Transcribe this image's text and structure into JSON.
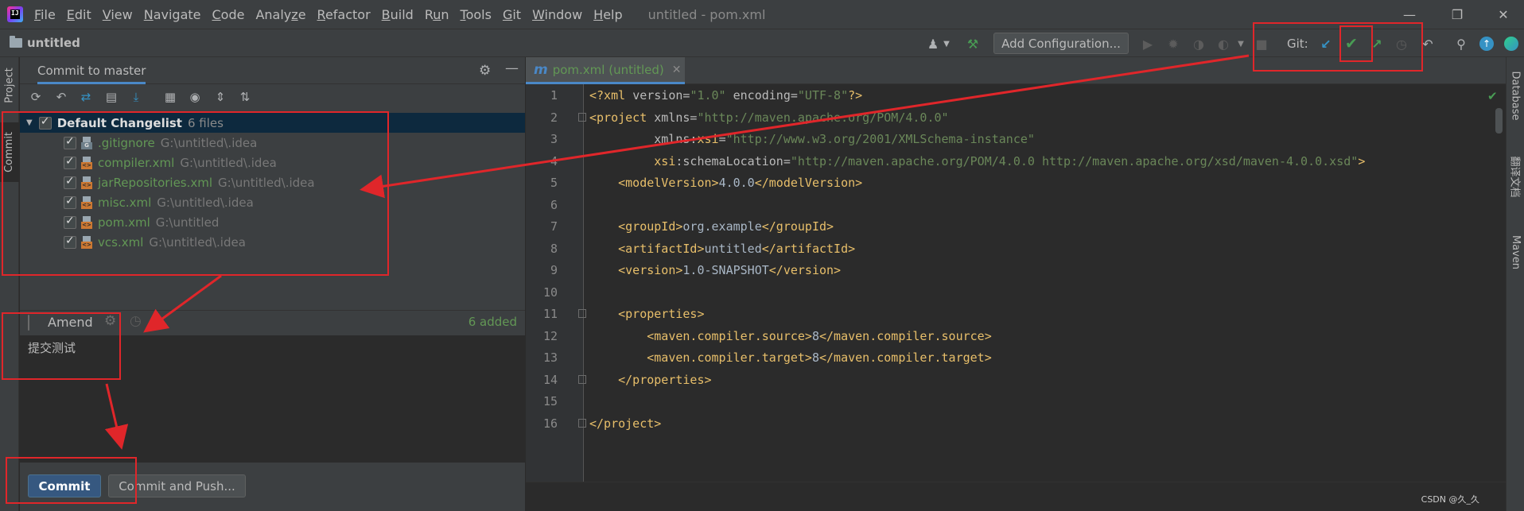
{
  "app": {
    "window_title": "untitled - pom.xml",
    "menu": [
      "File",
      "Edit",
      "View",
      "Navigate",
      "Code",
      "Analyze",
      "Refactor",
      "Build",
      "Run",
      "Tools",
      "Git",
      "Window",
      "Help"
    ],
    "menu_mnemonics": [
      "F",
      "E",
      "V",
      "N",
      "C",
      "z",
      "R",
      "B",
      "u",
      "T",
      "G",
      "W",
      "H"
    ]
  },
  "navbar": {
    "project": "untitled",
    "add_configuration": "Add Configuration...",
    "git_label": "Git:"
  },
  "left_stripe": {
    "project_tab": "Project",
    "commit_tab": "Commit"
  },
  "commit_panel": {
    "title": "Commit to master",
    "changelist": {
      "name": "Default Changelist",
      "count": "6 files",
      "files": [
        {
          "name": ".gitignore",
          "path": "G:\\untitled\\.idea"
        },
        {
          "name": "compiler.xml",
          "path": "G:\\untitled\\.idea"
        },
        {
          "name": "jarRepositories.xml",
          "path": "G:\\untitled\\.idea"
        },
        {
          "name": "misc.xml",
          "path": "G:\\untitled\\.idea"
        },
        {
          "name": "pom.xml",
          "path": "G:\\untitled"
        },
        {
          "name": "vcs.xml",
          "path": "G:\\untitled\\.idea"
        }
      ]
    },
    "amend_label": "Amend",
    "added_count": "6 added",
    "message": "提交测试",
    "commit_button": "Commit",
    "commit_push_button": "Commit and Push..."
  },
  "editor": {
    "tab_label": "pom.xml (untitled)",
    "tab_icon": "m",
    "line_numbers": [
      "1",
      "2",
      "3",
      "4",
      "5",
      "6",
      "7",
      "8",
      "9",
      "10",
      "11",
      "12",
      "13",
      "14",
      "15",
      "16"
    ]
  },
  "right_stripe": {
    "database_tab": "Database",
    "cn_tab": "翻译文档",
    "maven_tab": "Maven"
  },
  "watermark": "CSDN @久_久",
  "colors": {
    "accent": "#4a88c7",
    "annotation_red": "#e0262a",
    "git_green": "#499c54",
    "git_blue": "#3592c4"
  }
}
